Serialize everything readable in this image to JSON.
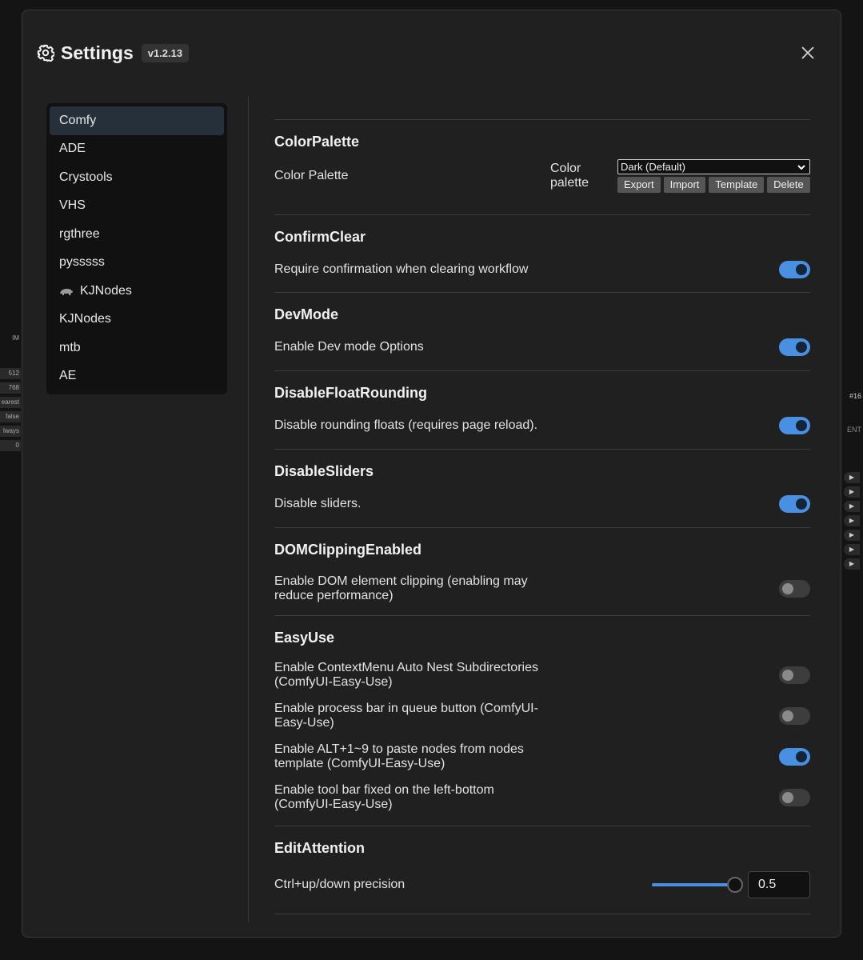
{
  "dialog": {
    "title": "Settings",
    "version": "v1.2.13"
  },
  "background": {
    "left_cells": [
      "IM",
      "512",
      "768",
      "earest",
      "false",
      "lways",
      "0"
    ],
    "right_text": "#16",
    "right_label": "ENT"
  },
  "sidebar": {
    "items": [
      {
        "label": "Comfy",
        "active": true
      },
      {
        "label": "ADE"
      },
      {
        "label": "Crystools"
      },
      {
        "label": "VHS"
      },
      {
        "label": "rgthree"
      },
      {
        "label": "pysssss"
      },
      {
        "label": "KJNodes",
        "icon": "rhino-icon"
      },
      {
        "label": "KJNodes"
      },
      {
        "label": "mtb"
      },
      {
        "label": "AE"
      }
    ]
  },
  "sections": {
    "color_palette": {
      "title": "ColorPalette",
      "setting": "Color Palette",
      "control_label": "Color palette",
      "selected": "Dark (Default)",
      "buttons": [
        "Export",
        "Import",
        "Template",
        "Delete"
      ]
    },
    "confirm_clear": {
      "title": "ConfirmClear",
      "setting": "Require confirmation when clearing workflow",
      "enabled": true
    },
    "dev_mode": {
      "title": "DevMode",
      "setting": "Enable Dev mode Options",
      "enabled": true
    },
    "disable_float_rounding": {
      "title": "DisableFloatRounding",
      "setting": "Disable rounding floats (requires page reload).",
      "enabled": true
    },
    "disable_sliders": {
      "title": "DisableSliders",
      "setting": "Disable sliders.",
      "enabled": true
    },
    "dom_clipping": {
      "title": "DOMClippingEnabled",
      "setting": "Enable DOM element clipping (enabling may reduce performance)",
      "enabled": false
    },
    "easy_use": {
      "title": "EasyUse",
      "settings": [
        {
          "label": "Enable ContextMenu Auto Nest Subdirectories (ComfyUI-Easy-Use)",
          "enabled": false
        },
        {
          "label": "Enable process bar in queue button (ComfyUI-Easy-Use)",
          "enabled": false
        },
        {
          "label": "Enable ALT+1~9 to paste nodes from nodes template (ComfyUI-Easy-Use)",
          "enabled": true
        },
        {
          "label": "Enable tool bar fixed on the left-bottom (ComfyUI-Easy-Use)",
          "enabled": false
        }
      ]
    },
    "edit_attention": {
      "title": "EditAttention",
      "setting": "Ctrl+up/down precision",
      "value": "0.5",
      "slider_fraction": 1.0
    }
  },
  "colors": {
    "accent": "#4a90e2",
    "modal_bg": "#202020",
    "sidebar_bg": "#111111"
  }
}
